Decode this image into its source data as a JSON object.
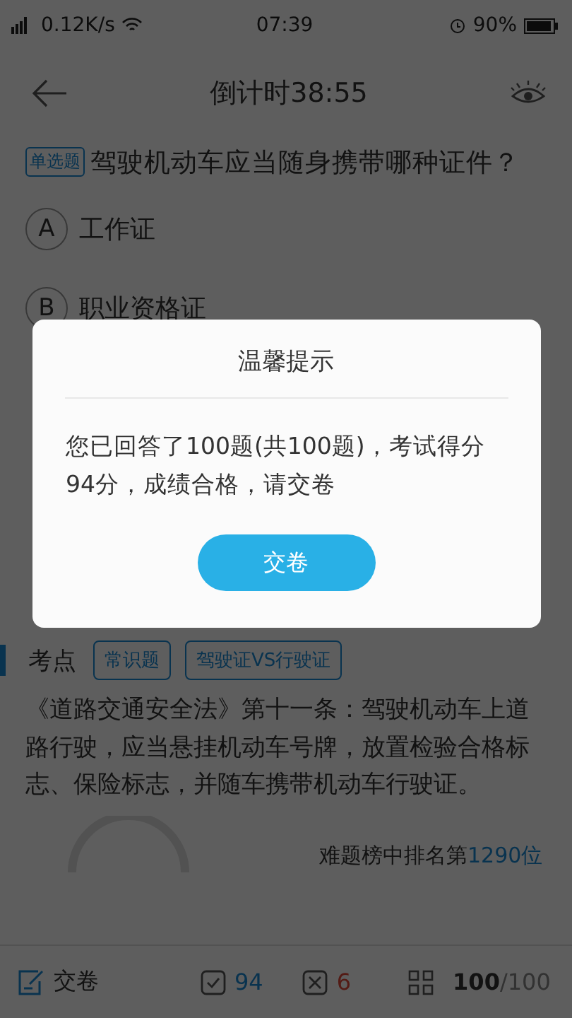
{
  "status_bar": {
    "network": "0.12K/s",
    "time": "07:39",
    "battery": "90%"
  },
  "header": {
    "title": "倒计时38:55"
  },
  "question": {
    "type_tag": "单选题",
    "text": "驾驶机动车应当随身携带哪种证件？"
  },
  "options": [
    {
      "letter": "A",
      "text": "工作证"
    },
    {
      "letter": "B",
      "text": "职业资格证"
    }
  ],
  "knowledge": {
    "label": "考点",
    "tags": [
      "常识题",
      "驾驶证VS行驶证"
    ]
  },
  "explanation": "《道路交通安全法》第十一条：驾驶机动车上道路行驶，应当悬挂机动车号牌，放置检验合格标志、保险标志，并随车携带机动车行驶证。",
  "rank": {
    "label": "难题榜中排名第",
    "value": "1290位"
  },
  "bottom_bar": {
    "submit": "交卷",
    "correct": "94",
    "wrong": "6",
    "current": "100",
    "total": "/100"
  },
  "dialog": {
    "title": "温馨提示",
    "message": "您已回答了100题(共100题)，考试得分94分，成绩合格，请交卷",
    "button": "交卷"
  }
}
